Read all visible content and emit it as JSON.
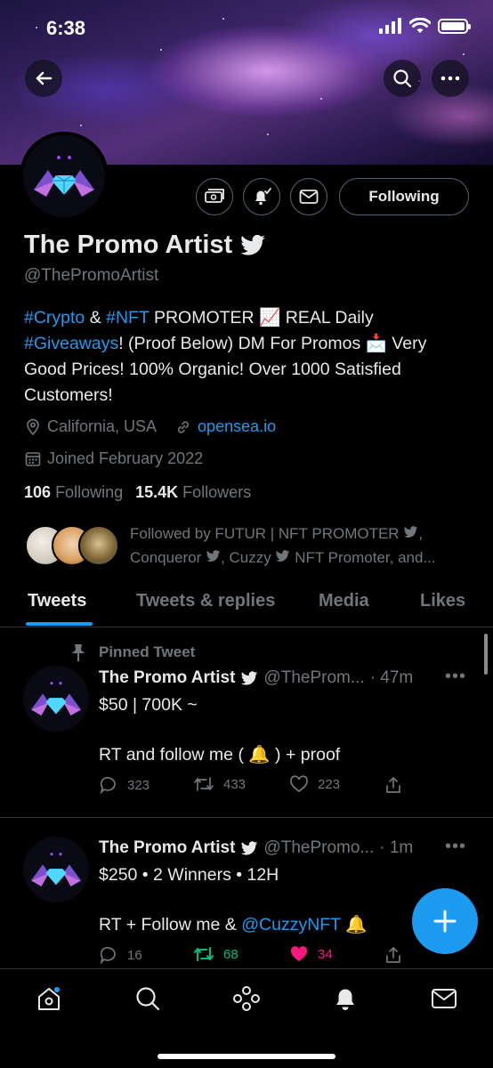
{
  "status": {
    "time": "6:38"
  },
  "profile": {
    "name": "The Promo Artist",
    "handle": "@ThePromoArtist",
    "follow_button": "Following",
    "bio": {
      "part1": "#Crypto",
      "part2": " & ",
      "part3": "#NFT",
      "part4": " PROMOTER 📈 REAL Daily ",
      "part5": "#Giveaways",
      "part6": "! (Proof Below) DM For Promos 📩 Very Good Prices! 100% Organic! Over 1000 Satisfied Customers!"
    },
    "location": "California, USA",
    "website": "opensea.io",
    "joined": "Joined February 2022",
    "following_count": "106",
    "following_label": "Following",
    "followers_count": "15.4K",
    "followers_label": "Followers",
    "followed_by_line1": "Followed by FUTUR | NFT PROMOTER",
    "followed_by_line2a": "Conqueror",
    "followed_by_line2b": ", Cuzzy",
    "followed_by_line2c": " NFT Promoter, and..."
  },
  "tabs": [
    "Tweets",
    "Tweets & replies",
    "Media",
    "Likes"
  ],
  "tweets": [
    {
      "pinned_label": "Pinned Tweet",
      "name": "The Promo Artist",
      "handle": "@TheProm...",
      "time": "· 47m",
      "line1": "$50 | 700K ~",
      "line2": "RT and follow me ( 🔔 ) + proof",
      "replies": "323",
      "retweets": "433",
      "likes": "223"
    },
    {
      "name": "The Promo Artist",
      "handle": "@ThePromo...",
      "time": "· 1m",
      "line1": "$250 • 2 Winners • 12H",
      "line2a": "RT + Follow me & ",
      "line2b": "@CuzzyNFT",
      "line2c": " 🔔",
      "replies": "16",
      "retweets": "68",
      "likes": "34"
    }
  ],
  "colors": {
    "accent": "#1d9bf0",
    "retweet": "#00ba7c",
    "like": "#f91880",
    "muted": "#71767b"
  }
}
